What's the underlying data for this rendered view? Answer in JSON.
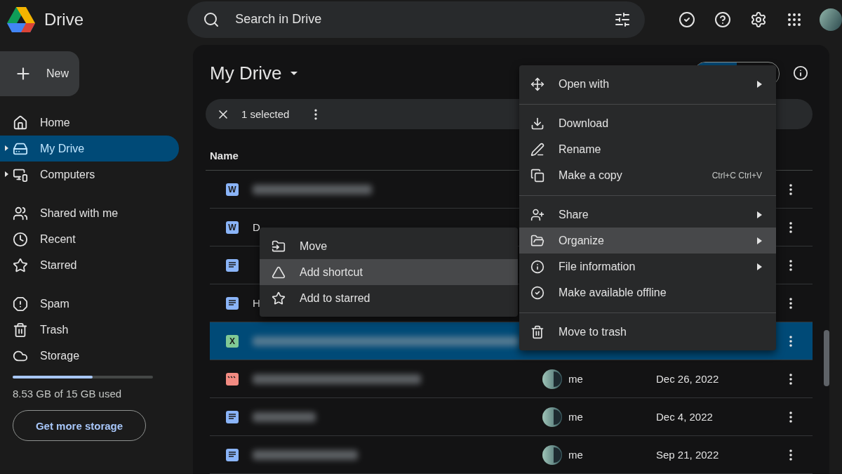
{
  "app": {
    "name": "Drive"
  },
  "search": {
    "placeholder": "Search in Drive"
  },
  "new_button": "New",
  "nav": [
    [
      {
        "label": "Home",
        "selected": false,
        "expandable": false
      },
      {
        "label": "My Drive",
        "selected": true,
        "expandable": true
      },
      {
        "label": "Computers",
        "selected": false,
        "expandable": true
      }
    ],
    [
      {
        "label": "Shared with me",
        "selected": false,
        "expandable": false
      },
      {
        "label": "Recent",
        "selected": false,
        "expandable": false
      },
      {
        "label": "Starred",
        "selected": false,
        "expandable": false
      }
    ],
    [
      {
        "label": "Spam",
        "selected": false,
        "expandable": false
      },
      {
        "label": "Trash",
        "selected": false,
        "expandable": false
      },
      {
        "label": "Storage",
        "selected": false,
        "expandable": false
      }
    ]
  ],
  "storage": {
    "level": 0.57,
    "usage": "8.53 GB of 15 GB used",
    "button": "Get more storage"
  },
  "main": {
    "title": "My Drive",
    "selection": "1 selected",
    "name_column": "Name",
    "rows": [
      {
        "kind": "word",
        "badge": "W",
        "blurred": true,
        "selected": false
      },
      {
        "kind": "word",
        "badge": "W",
        "name": "D",
        "blurred": false,
        "selected": false
      },
      {
        "kind": "doc",
        "blurred": false,
        "selected": false
      },
      {
        "kind": "doc",
        "name": "H",
        "blurred": false,
        "selected": false
      },
      {
        "kind": "sheet",
        "badge": "X",
        "blurred": true,
        "selected": true
      },
      {
        "kind": "video",
        "blurred": true,
        "selected": false,
        "owner": "me",
        "date": "Dec 26, 2022"
      },
      {
        "kind": "doc",
        "blurred": true,
        "selected": false,
        "owner": "me",
        "date": "Dec 4, 2022"
      },
      {
        "kind": "doc",
        "blurred": true,
        "selected": false,
        "owner": "me",
        "date": "Sep 21, 2022"
      }
    ]
  },
  "context_menu": {
    "items": [
      {
        "label": "Open with",
        "submenu": true,
        "divider_before": false,
        "highlighted": false
      },
      {
        "label": "Download",
        "submenu": false,
        "divider_before": true,
        "highlighted": false
      },
      {
        "label": "Rename",
        "submenu": false,
        "divider_before": false,
        "highlighted": false
      },
      {
        "label": "Make a copy",
        "shortcut": "Ctrl+C Ctrl+V",
        "submenu": false,
        "divider_before": false,
        "highlighted": false
      },
      {
        "label": "Share",
        "submenu": true,
        "divider_before": true,
        "highlighted": false
      },
      {
        "label": "Organize",
        "submenu": true,
        "divider_before": false,
        "highlighted": true
      },
      {
        "label": "File information",
        "submenu": true,
        "divider_before": false,
        "highlighted": false
      },
      {
        "label": "Make available offline",
        "submenu": false,
        "divider_before": false,
        "highlighted": false
      },
      {
        "label": "Move to trash",
        "submenu": false,
        "divider_before": true,
        "highlighted": false
      }
    ]
  },
  "submenu": {
    "items": [
      {
        "label": "Move",
        "highlighted": false
      },
      {
        "label": "Add shortcut",
        "highlighted": true
      },
      {
        "label": "Add to starred",
        "highlighted": false
      }
    ]
  }
}
